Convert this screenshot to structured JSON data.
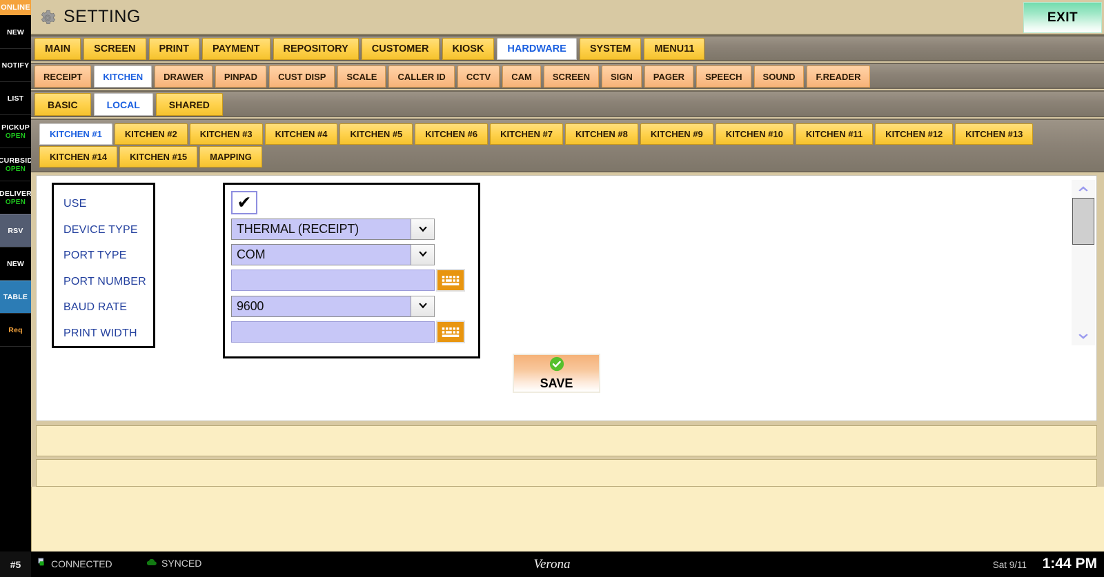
{
  "sidebar": {
    "online_badge": "ONLINE",
    "items": [
      {
        "label": "NEW",
        "sub": "",
        "state": "normal"
      },
      {
        "label": "NOTIFY",
        "sub": "",
        "state": "normal"
      },
      {
        "label": "LIST",
        "sub": "",
        "state": "normal"
      },
      {
        "label": "PICKUP",
        "sub": "OPEN",
        "state": "normal"
      },
      {
        "label": "CURBSID",
        "sub": "OPEN",
        "state": "normal"
      },
      {
        "label": "DELIVER",
        "sub": "OPEN",
        "state": "normal"
      },
      {
        "label": "RSV",
        "sub": "",
        "state": "rsv"
      },
      {
        "label": "NEW",
        "sub": "",
        "state": "normal"
      },
      {
        "label": "TABLE",
        "sub": "",
        "state": "table"
      },
      {
        "label": "Req",
        "sub": "",
        "state": "req"
      }
    ]
  },
  "header": {
    "title": "SETTING",
    "gear_icon": "gear-icon",
    "exit_label": "EXIT"
  },
  "main_tabs": [
    {
      "label": "MAIN",
      "active": false
    },
    {
      "label": "SCREEN",
      "active": false
    },
    {
      "label": "PRINT",
      "active": false
    },
    {
      "label": "PAYMENT",
      "active": false
    },
    {
      "label": "REPOSITORY",
      "active": false
    },
    {
      "label": "CUSTOMER",
      "active": false
    },
    {
      "label": "KIOSK",
      "active": false
    },
    {
      "label": "HARDWARE",
      "active": true
    },
    {
      "label": "SYSTEM",
      "active": false
    },
    {
      "label": "MENU11",
      "active": false
    }
  ],
  "hardware_tabs": [
    {
      "label": "RECEIPT",
      "active": false
    },
    {
      "label": "KITCHEN",
      "active": true
    },
    {
      "label": "DRAWER",
      "active": false
    },
    {
      "label": "PINPAD",
      "active": false
    },
    {
      "label": "CUST DISP",
      "active": false
    },
    {
      "label": "SCALE",
      "active": false
    },
    {
      "label": "CALLER ID",
      "active": false
    },
    {
      "label": "CCTV",
      "active": false
    },
    {
      "label": "CAM",
      "active": false
    },
    {
      "label": "SCREEN",
      "active": false
    },
    {
      "label": "SIGN",
      "active": false
    },
    {
      "label": "PAGER",
      "active": false
    },
    {
      "label": "SPEECH",
      "active": false
    },
    {
      "label": "SOUND",
      "active": false
    },
    {
      "label": "F.READER",
      "active": false
    }
  ],
  "scope_tabs": [
    {
      "label": "BASIC",
      "active": false
    },
    {
      "label": "LOCAL",
      "active": true
    },
    {
      "label": "SHARED",
      "active": false
    }
  ],
  "kitchen_tabs_row1": [
    {
      "label": "KITCHEN #1",
      "active": true
    },
    {
      "label": "KITCHEN #2",
      "active": false
    },
    {
      "label": "KITCHEN #3",
      "active": false
    },
    {
      "label": "KITCHEN #4",
      "active": false
    },
    {
      "label": "KITCHEN #5",
      "active": false
    },
    {
      "label": "KITCHEN #6",
      "active": false
    },
    {
      "label": "KITCHEN #7",
      "active": false
    },
    {
      "label": "KITCHEN #8",
      "active": false
    },
    {
      "label": "KITCHEN #9",
      "active": false
    },
    {
      "label": "KITCHEN #10",
      "active": false
    },
    {
      "label": "KITCHEN #11",
      "active": false
    },
    {
      "label": "KITCHEN #12",
      "active": false
    },
    {
      "label": "KITCHEN #13",
      "active": false
    }
  ],
  "kitchen_tabs_row2": [
    {
      "label": "KITCHEN #14",
      "active": false
    },
    {
      "label": "KITCHEN #15",
      "active": false
    },
    {
      "label": "MAPPING",
      "active": false
    }
  ],
  "form": {
    "labels": {
      "use": "USE",
      "device_type": "DEVICE TYPE",
      "port_type": "PORT TYPE",
      "port_number": "PORT NUMBER",
      "baud_rate": "BAUD RATE",
      "print_width": "PRINT WIDTH"
    },
    "values": {
      "use_checked": "✔",
      "device_type": "THERMAL (RECEIPT)",
      "port_type": "COM",
      "port_number": "",
      "baud_rate": "9600",
      "print_width": ""
    },
    "keyboard_icon": "keyboard-icon",
    "dropdown_icon": "chevron-down-icon"
  },
  "save_button": {
    "label": "SAVE",
    "icon": "check-circle-icon"
  },
  "scrollbar": {
    "up_icon": "chevron-up-icon",
    "down_icon": "chevron-down-icon"
  },
  "status_bar": {
    "terminal": "#5",
    "connection": "CONNECTED",
    "connection_icon": "network-plug-icon",
    "sync": "SYNCED",
    "sync_icon": "cloud-icon",
    "brand": "Verona",
    "date": "Sat 9/11",
    "time": "1:44 PM"
  },
  "colors": {
    "tab_yellow": "#ffd24d",
    "tab_peach": "#f7b478",
    "active_tab_text": "#1a5fe0",
    "field_bg": "#c7c7f7",
    "label_text": "#23409e",
    "accent_orange": "#e8950f",
    "status_green": "#1ec81e",
    "header_bg": "#d8c9a3",
    "cream_panel": "#fbeec3"
  }
}
